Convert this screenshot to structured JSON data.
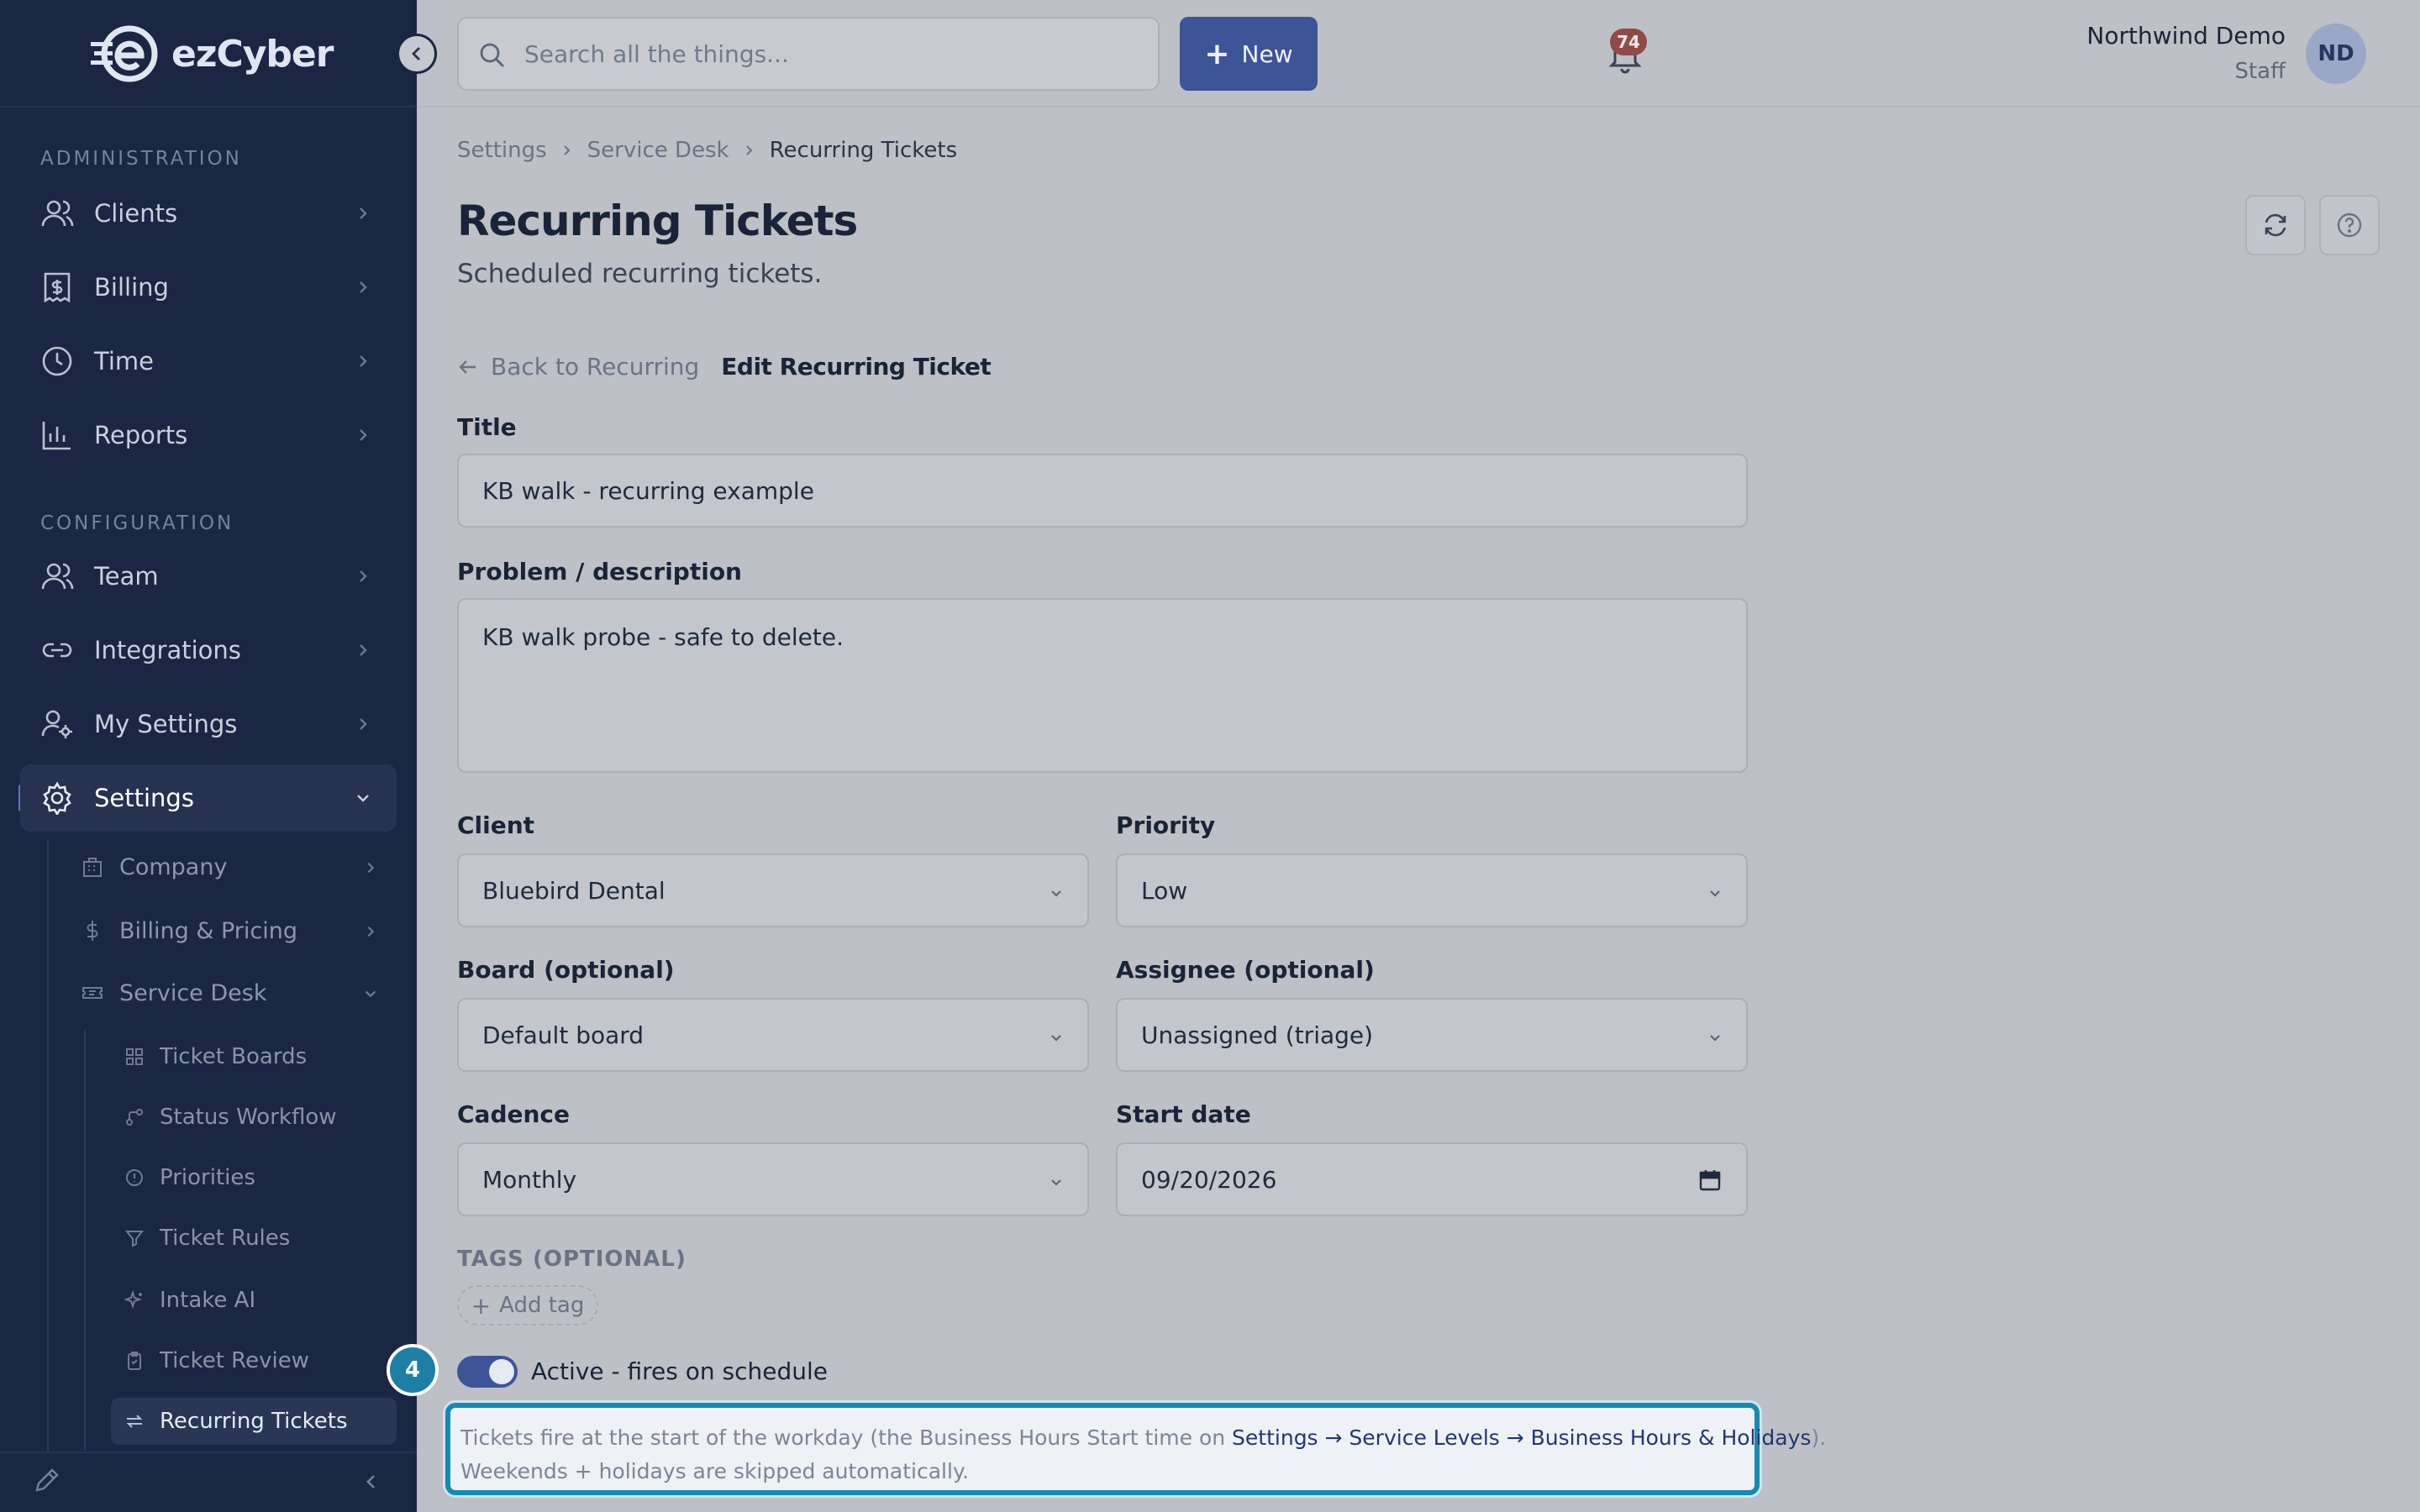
{
  "app": {
    "logo_text": "ezCyber"
  },
  "sidebar": {
    "sections": [
      {
        "label": "ADMINISTRATION"
      },
      {
        "label": "CONFIGURATION"
      }
    ],
    "items": [
      {
        "label": "Clients",
        "icon": "users-icon"
      },
      {
        "label": "Billing",
        "icon": "receipt-icon"
      },
      {
        "label": "Time",
        "icon": "clock-icon"
      },
      {
        "label": "Reports",
        "icon": "bar-chart-icon"
      },
      {
        "label": "Team",
        "icon": "team-icon"
      },
      {
        "label": "Integrations",
        "icon": "link-icon"
      },
      {
        "label": "My Settings",
        "icon": "user-cog-icon"
      },
      {
        "label": "Settings",
        "icon": "gear-icon"
      }
    ],
    "settings_children": [
      {
        "label": "Company",
        "icon": "building-icon"
      },
      {
        "label": "Billing & Pricing",
        "icon": "dollar-icon"
      },
      {
        "label": "Service Desk",
        "icon": "ticket-icon"
      }
    ],
    "service_desk_children": [
      {
        "label": "Ticket Boards",
        "icon": "grid-icon"
      },
      {
        "label": "Status Workflow",
        "icon": "workflow-icon"
      },
      {
        "label": "Priorities",
        "icon": "alert-circle-icon"
      },
      {
        "label": "Ticket Rules",
        "icon": "filter-icon"
      },
      {
        "label": "Intake AI",
        "icon": "sparkles-icon"
      },
      {
        "label": "Ticket Review",
        "icon": "clipboard-icon"
      },
      {
        "label": "Recurring Tickets",
        "icon": "repeat-icon"
      }
    ]
  },
  "topbar": {
    "search_placeholder": "Search all the things...",
    "new_label": "New",
    "notification_count": "74",
    "user_name": "Northwind Demo",
    "user_role": "Staff",
    "avatar_initials": "ND"
  },
  "breadcrumb": [
    "Settings",
    "Service Desk",
    "Recurring Tickets"
  ],
  "page": {
    "title": "Recurring Tickets",
    "subtitle": "Scheduled recurring tickets."
  },
  "form": {
    "back_label": "Back to Recurring",
    "edit_label": "Edit Recurring Ticket",
    "title_label": "Title",
    "title_value": "KB walk - recurring example",
    "description_label": "Problem / description",
    "description_value": "KB walk probe - safe to delete.",
    "client_label": "Client",
    "client_value": "Bluebird Dental",
    "priority_label": "Priority",
    "priority_value": "Low",
    "board_label": "Board (optional)",
    "board_value": "Default board",
    "assignee_label": "Assignee (optional)",
    "assignee_value": "Unassigned (triage)",
    "cadence_label": "Cadence",
    "cadence_value": "Monthly",
    "start_date_label": "Start date",
    "start_date_value": "09/20/2026",
    "tags_label": "TAGS (OPTIONAL)",
    "add_tag_label": "Add tag",
    "active_label": "Active - fires on schedule",
    "active": true
  },
  "hint": {
    "step_number": "4",
    "text_before": "Tickets fire at the start of the workday (the Business Hours Start time on ",
    "link_text": "Settings → Service Levels → Business Hours & Holidays",
    "text_after": ").",
    "line2": "Weekends + holidays are skipped automatically."
  },
  "colors": {
    "sidebar_bg": "#1b2642",
    "accent": "#3d5497",
    "highlight": "#1a88b0",
    "badge": "#8f4b48"
  }
}
